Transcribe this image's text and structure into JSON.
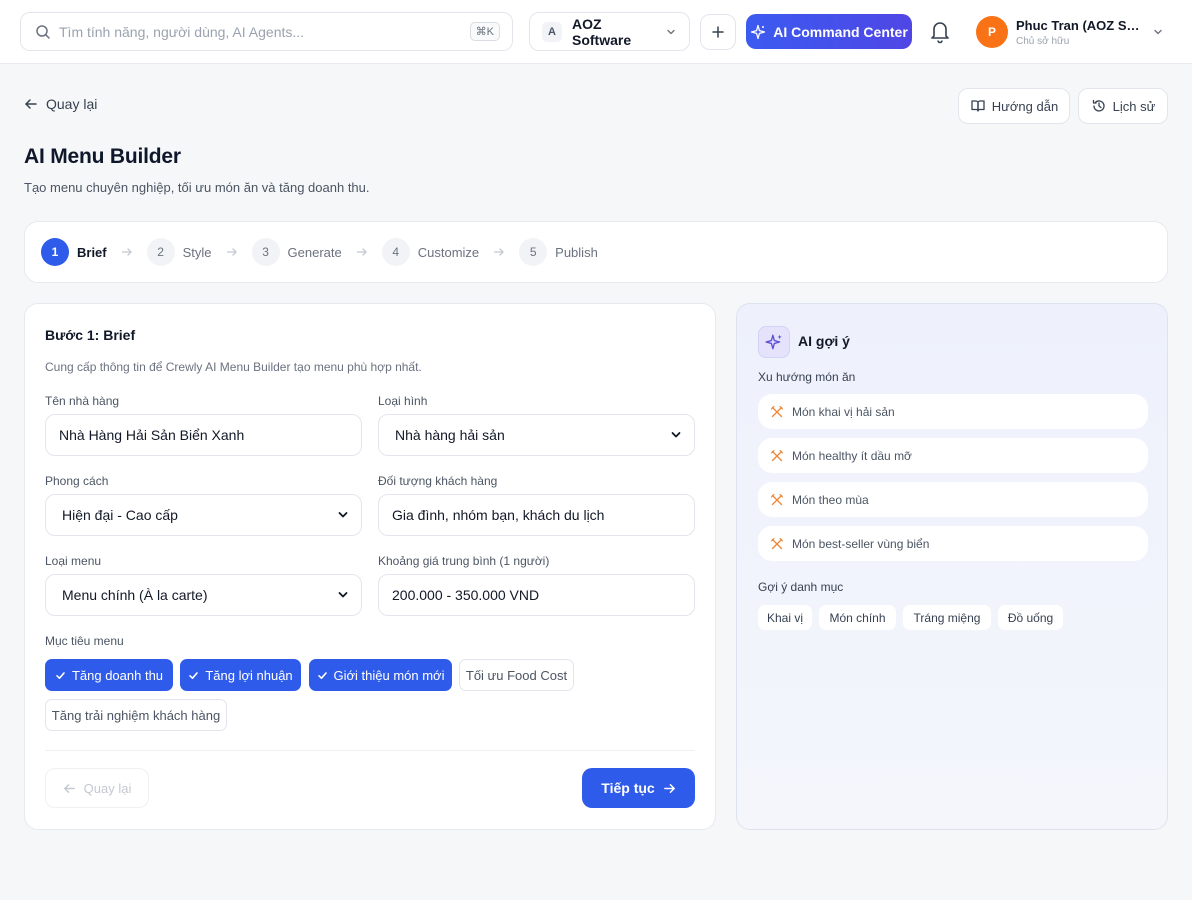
{
  "topbar": {
    "search_placeholder": "Tìm tính năng, người dùng, AI Agents...",
    "search_shortcut": "⌘K",
    "workspace_badge": "A",
    "workspace_name": "AOZ Software",
    "ai_command_label": "AI Command Center",
    "user": {
      "initial": "P",
      "name": "Phuc Tran (AOZ Software)",
      "role": "Chủ sở hữu"
    }
  },
  "header": {
    "back_label": "Quay lại",
    "guide_label": "Hướng dẫn",
    "history_label": "Lịch sử",
    "title": "AI Menu Builder",
    "subtitle": "Tạo menu chuyên nghiệp, tối ưu món ăn và tăng doanh thu."
  },
  "steps": [
    {
      "num": "1",
      "label": "Brief",
      "active": true
    },
    {
      "num": "2",
      "label": "Style",
      "active": false
    },
    {
      "num": "3",
      "label": "Generate",
      "active": false
    },
    {
      "num": "4",
      "label": "Customize",
      "active": false
    },
    {
      "num": "5",
      "label": "Publish",
      "active": false
    }
  ],
  "form": {
    "title": "Bước 1: Brief",
    "description": "Cung cấp thông tin để Crewly AI Menu Builder tạo menu phù hợp nhất.",
    "restaurant_name": {
      "label": "Tên nhà hàng",
      "value": "Nhà Hàng Hải Sản Biển Xanh"
    },
    "type": {
      "label": "Loại hình",
      "value": "Nhà hàng hải sản"
    },
    "style": {
      "label": "Phong cách",
      "value": "Hiện đại - Cao cấp"
    },
    "audience": {
      "label": "Đối tượng khách hàng",
      "value": "Gia đình, nhóm bạn, khách du lịch"
    },
    "menu_type": {
      "label": "Loại menu",
      "value": "Menu chính (À la carte)"
    },
    "price": {
      "label": "Khoảng giá trung bình (1 người)",
      "value": "200.000 - 350.000 VND"
    },
    "goals_label": "Mục tiêu menu",
    "goals": [
      {
        "label": "Tăng doanh thu",
        "selected": true
      },
      {
        "label": "Tăng lợi nhuận",
        "selected": true
      },
      {
        "label": "Giới thiệu món mới",
        "selected": true
      },
      {
        "label": "Tối ưu Food Cost",
        "selected": false
      },
      {
        "label": "Tăng trải nghiệm khách hàng",
        "selected": false
      }
    ],
    "back_button": "Quay lại",
    "next_button": "Tiếp tục"
  },
  "ai": {
    "title": "AI gợi ý",
    "trends_label": "Xu hướng món ăn",
    "trends": [
      "Món khai vị hải sản",
      "Món healthy ít dầu mỡ",
      "Món theo mùa",
      "Món best-seller vùng biển"
    ],
    "categories_label": "Gợi ý danh mục",
    "categories": [
      "Khai vị",
      "Món chính",
      "Tráng miệng",
      "Đồ uống"
    ]
  },
  "colors": {
    "primary": "#2f5bea",
    "avatar": "#f97316",
    "trend_icon": "#ea8a3c"
  }
}
